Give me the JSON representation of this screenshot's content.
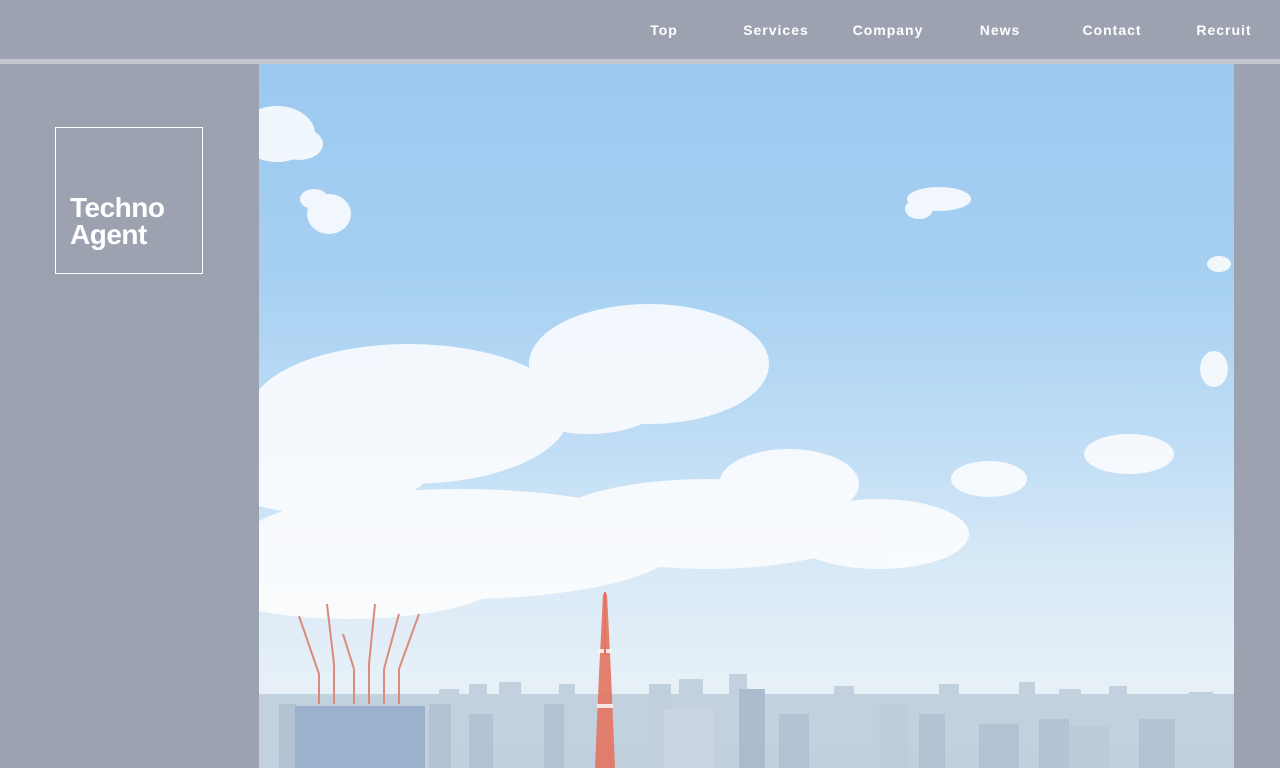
{
  "header": {
    "nav": [
      "Top",
      "Services",
      "Company",
      "News",
      "Contact",
      "Recruit"
    ]
  },
  "sidebar": {
    "logo": {
      "line1": "Techno",
      "line2": "Agent"
    }
  },
  "hero": {
    "image_alt": "sky-and-city-skyline",
    "colors": {
      "sky_top": "#8fc1ef",
      "sky_bottom": "#e4eef6",
      "tower": "#e0604a"
    }
  }
}
